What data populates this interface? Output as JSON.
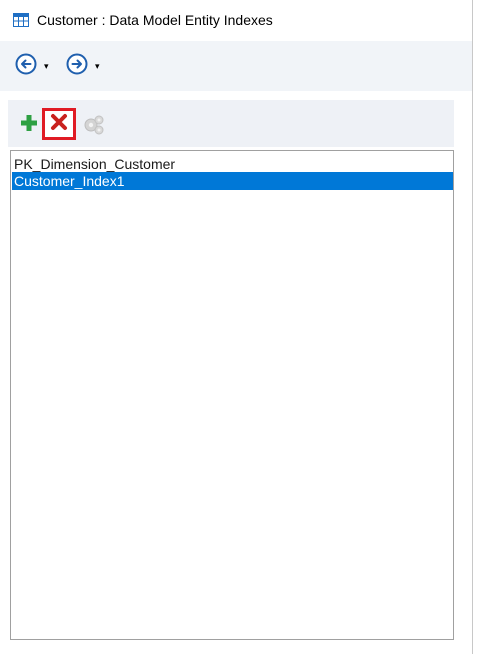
{
  "window": {
    "title": "Customer : Data Model Entity Indexes",
    "icon": "table-icon"
  },
  "navigation": {
    "back_icon": "back-arrow-icon",
    "forward_icon": "forward-arrow-icon",
    "dropdown_glyph": "▾"
  },
  "toolbar": {
    "add_icon": "plus-icon",
    "delete_icon": "delete-x-icon",
    "properties_icon": "properties-gear-icon",
    "properties_enabled": false
  },
  "indexes": {
    "items": [
      {
        "label": "PK_Dimension_Customer",
        "selected": false
      },
      {
        "label": "Customer_Index1",
        "selected": true
      }
    ]
  },
  "colors": {
    "selection": "#0078d7",
    "add_green": "#2ea043",
    "delete_red": "#c9211e",
    "highlight_border": "#e01b24",
    "toolbar_bg": "#eef1f6",
    "nav_bg": "#f1f4f8",
    "nav_arrow": "#1f5fae"
  }
}
